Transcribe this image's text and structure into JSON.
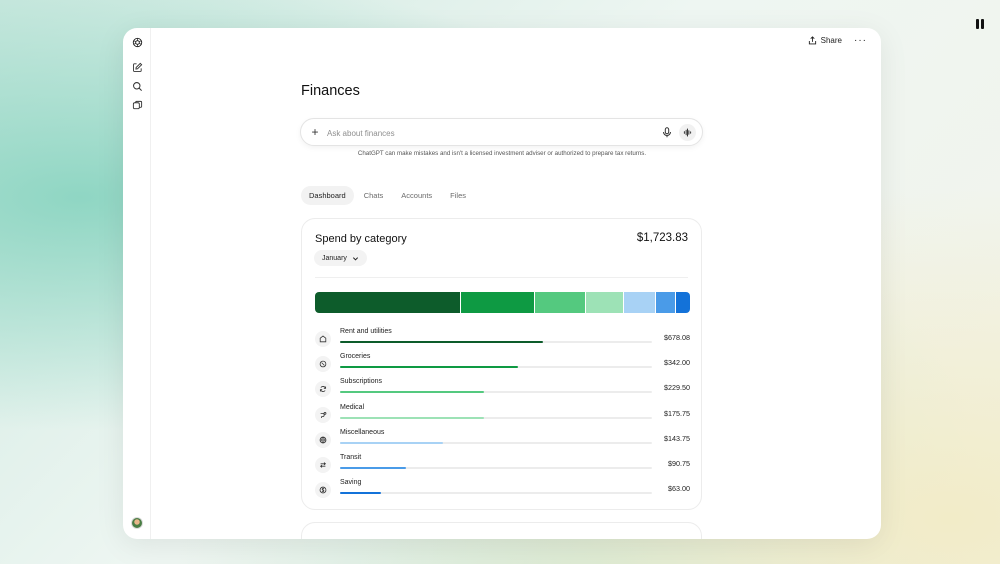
{
  "window": {
    "share_label": "Share",
    "more_label": "···"
  },
  "page": {
    "title": "Finances"
  },
  "composer": {
    "placeholder": "Ask about finances",
    "plus": "+",
    "disclaimer": "ChatGPT can make mistakes and isn't a licensed investment adviser or authorized to prepare tax returns."
  },
  "tabs": [
    {
      "label": "Dashboard",
      "active": true
    },
    {
      "label": "Chats",
      "active": false
    },
    {
      "label": "Accounts",
      "active": false
    },
    {
      "label": "Files",
      "active": false
    }
  ],
  "spend": {
    "title": "Spend by category",
    "total": "$1,723.83",
    "month": "January",
    "categories": [
      {
        "label": "Rent and utilities",
        "amount": "$678.08",
        "value": 678.08,
        "fraction": 0.65,
        "color": "#0d5c2b",
        "icon": "home-icon"
      },
      {
        "label": "Groceries",
        "amount": "$342.00",
        "value": 342.0,
        "fraction": 0.57,
        "color": "#0e9a43",
        "icon": "groceries-icon"
      },
      {
        "label": "Subscriptions",
        "amount": "$229.50",
        "value": 229.5,
        "fraction": 0.46,
        "color": "#54c97f",
        "icon": "refresh-icon"
      },
      {
        "label": "Medical",
        "amount": "$175.75",
        "value": 175.75,
        "fraction": 0.46,
        "color": "#9de2b6",
        "icon": "medical-icon"
      },
      {
        "label": "Miscellaneous",
        "amount": "$143.75",
        "value": 143.75,
        "fraction": 0.33,
        "color": "#a8d2f5",
        "icon": "globe-icon"
      },
      {
        "label": "Transit",
        "amount": "$90.75",
        "value": 90.75,
        "fraction": 0.21,
        "color": "#4a9be8",
        "icon": "transfer-icon"
      },
      {
        "label": "Saving",
        "amount": "$63.00",
        "value": 63.0,
        "fraction": 0.13,
        "color": "#1372d9",
        "icon": "dollar-icon"
      }
    ]
  }
}
